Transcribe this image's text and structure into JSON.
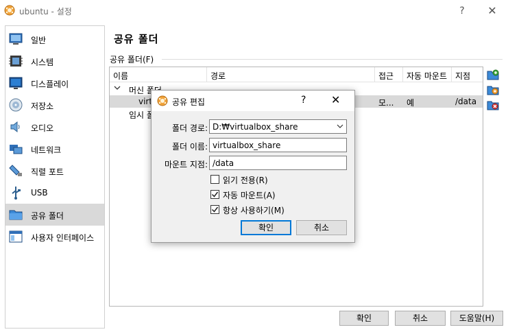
{
  "window": {
    "title": "ubuntu - 설정",
    "help": "?",
    "close": "✕"
  },
  "sidebar": {
    "items": [
      {
        "label": "일반",
        "icon": "general-icon"
      },
      {
        "label": "시스템",
        "icon": "system-icon"
      },
      {
        "label": "디스플레이",
        "icon": "display-icon"
      },
      {
        "label": "저장소",
        "icon": "storage-icon"
      },
      {
        "label": "오디오",
        "icon": "audio-icon"
      },
      {
        "label": "네트워크",
        "icon": "network-icon"
      },
      {
        "label": "직렬 포트",
        "icon": "serial-port-icon"
      },
      {
        "label": "USB",
        "icon": "usb-icon"
      },
      {
        "label": "공유 폴더",
        "icon": "shared-folder-icon",
        "selected": true
      },
      {
        "label": "사용자 인터페이스",
        "icon": "user-interface-icon"
      }
    ]
  },
  "main": {
    "title": "공유 폴더",
    "group_label": "공유 폴더(F)",
    "columns": [
      "이름",
      "경로",
      "접근",
      "자동 마운트",
      "지점"
    ],
    "rows": [
      {
        "name": "머신 폴더",
        "type": "group"
      },
      {
        "name": "virt",
        "path": "",
        "access": "모...",
        "auto_mount": "예",
        "mount_point": "/data",
        "selected": true
      },
      {
        "name": "임시 폴",
        "type": "group"
      }
    ],
    "tools": [
      "add-folder-icon",
      "edit-folder-icon",
      "remove-folder-icon"
    ]
  },
  "buttons": {
    "ok": "확인",
    "cancel": "취소",
    "help": "도움말(H)"
  },
  "dialog": {
    "title": "공유 편집",
    "help": "?",
    "close": "✕",
    "path_label": "폴더 경로:",
    "path_value": "D:₩virtualbox_share",
    "name_label": "폴더 이름:",
    "name_value": "virtualbox_share",
    "mount_label": "마운트 지점:",
    "mount_value": "/data",
    "readonly_label": "읽기 전용(R)",
    "readonly_checked": false,
    "automount_label": "자동 마운트(A)",
    "automount_checked": true,
    "permanent_label": "항상 사용하기(M)",
    "permanent_checked": true,
    "ok": "확인",
    "cancel": "취소"
  },
  "colors": {
    "accent": "#0078d7",
    "selected_bg": "#d9d9d9",
    "dialog_bg": "#f0f0f0"
  }
}
